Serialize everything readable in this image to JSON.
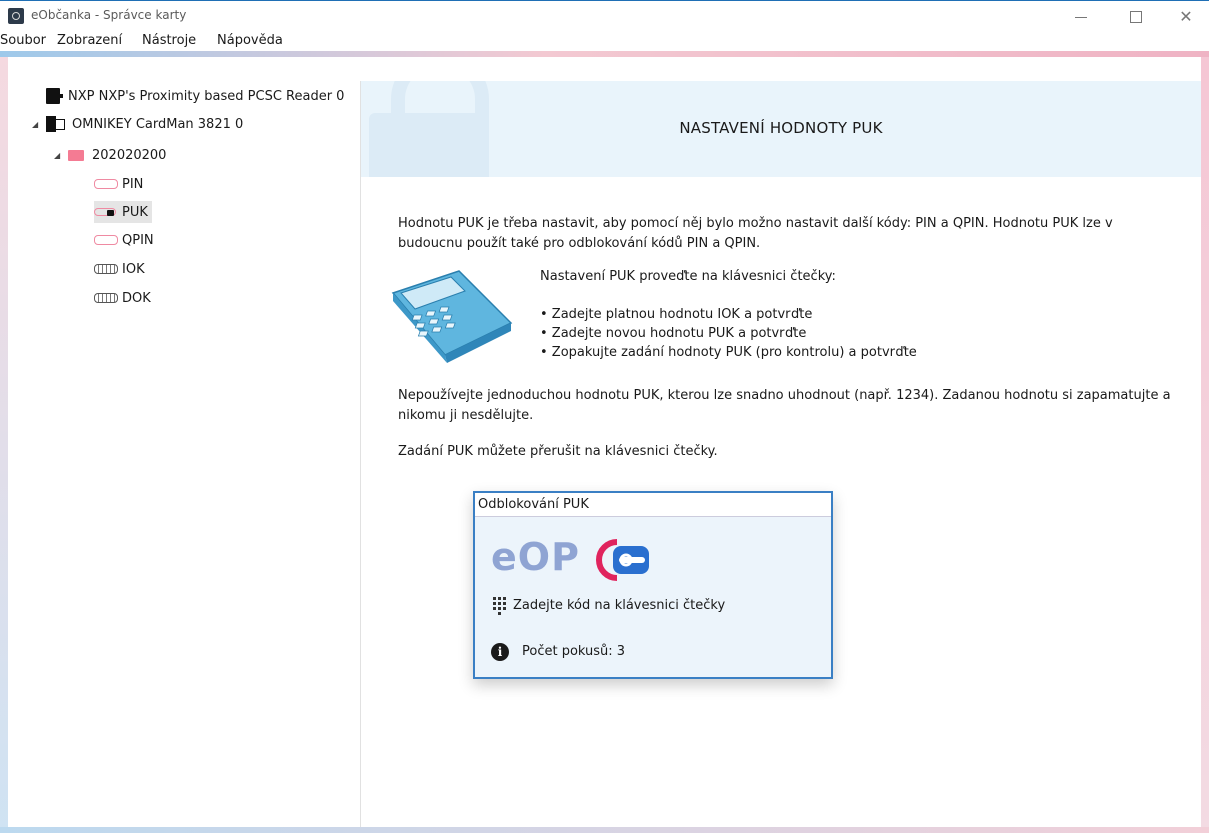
{
  "window": {
    "title": "eObčanka - Správce karty",
    "accent_color": "#1f6fb5"
  },
  "menu": [
    "Soubor",
    "Zobrazení",
    "Nástroje",
    "Nápověda"
  ],
  "tree": {
    "readers": [
      {
        "label": "NXP NXP's Proximity based PCSC Reader 0"
      },
      {
        "label": "OMNIKEY CardMan 3821 0"
      }
    ],
    "card": {
      "label": "202020200"
    },
    "items": [
      {
        "label": "PIN",
        "icon": "pin-key-icon"
      },
      {
        "label": "PUK",
        "icon": "puk-lock-icon",
        "selected": true
      },
      {
        "label": "QPIN",
        "icon": "qpin-key-icon"
      },
      {
        "label": "IOK",
        "icon": "iok-key-icon"
      },
      {
        "label": "DOK",
        "icon": "dok-key-icon"
      }
    ]
  },
  "main": {
    "title": "NASTAVENÍ HODNOTY PUK",
    "intro_line1": "Hodnotu PUK je třeba nastavit, aby pomocí něj bylo možno nastavit další kódy: PIN a QPIN. Hodnotu PUK lze v",
    "intro_line2": "budoucnu použít také pro odblokování kódů PIN a QPIN.",
    "instructions_heading": "Nastavení PUK proveďte na klávesnici čtečky:",
    "steps": [
      "• Zadejte platnou hodnotu IOK a potvrďte",
      "• Zadejte novou hodnotu PUK a potvrďte",
      "• Zopakujte zadání hodnoty PUK (pro kontrolu) a potvrďte"
    ],
    "warning_line1": "Nepoužívejte jednoduchou hodnotu PUK, kterou lze snadno uhodnout (např. 1234). Zadanou hodnotu si zapamatujte a",
    "warning_line2": "nikomu ji nesdělujte.",
    "cancel_note": "Zadání PUK můžete přerušit na klávesnici čtečky."
  },
  "dialog": {
    "title": "Odblokování PUK",
    "logo_text": "eOP",
    "prompt": "Zadejte kód na klávesnici čtečky",
    "attempts": "Počet pokusů: 3"
  },
  "colors": {
    "logo_text": "#8fa4d3",
    "logo_red": "#e0245e",
    "logo_blue": "#2a6fcf",
    "dialog_border": "#3a7fc4"
  }
}
